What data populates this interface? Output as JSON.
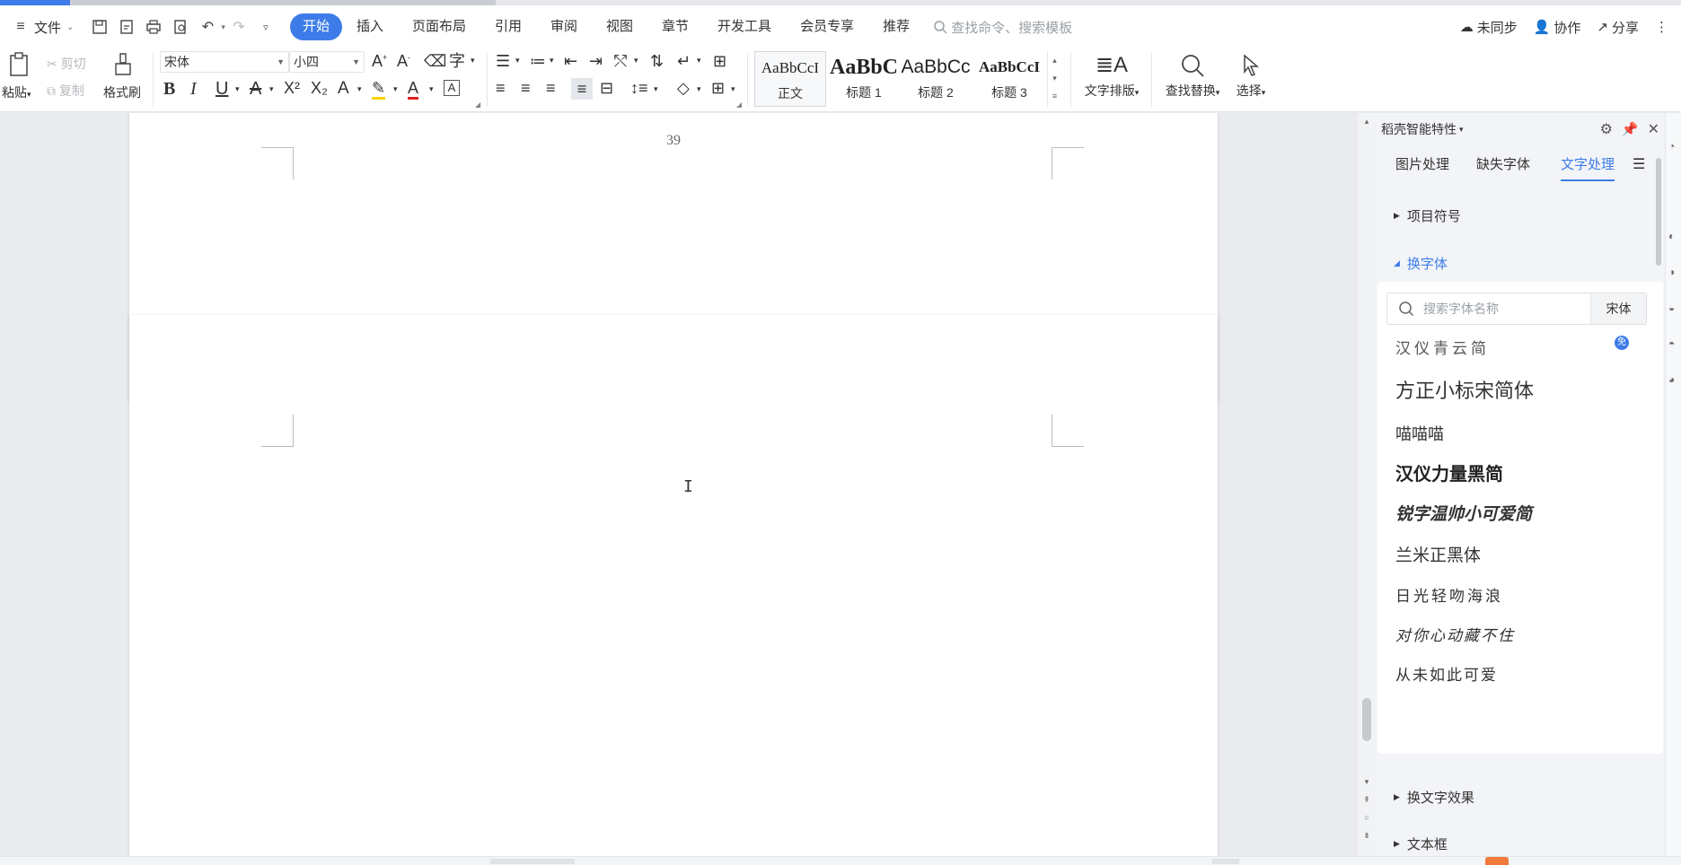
{
  "menubar": {
    "file_label": "文件",
    "tabs": [
      {
        "label": "开始",
        "active": true
      },
      {
        "label": "插入",
        "active": false
      },
      {
        "label": "页面布局",
        "active": false
      },
      {
        "label": "引用",
        "active": false
      },
      {
        "label": "审阅",
        "active": false
      },
      {
        "label": "视图",
        "active": false
      },
      {
        "label": "章节",
        "active": false
      },
      {
        "label": "开发工具",
        "active": false
      },
      {
        "label": "会员专享",
        "active": false
      },
      {
        "label": "推荐",
        "active": false
      }
    ],
    "search_placeholder": "查找命令、搜索模板",
    "sync_label": "未同步",
    "collab_label": "协作",
    "share_label": "分享"
  },
  "ribbon": {
    "paste_label": "粘贴",
    "cut_label": "剪切",
    "copy_label": "复制",
    "format_painter_label": "格式刷",
    "font_family_value": "宋体",
    "font_size_value": "小四",
    "styles": [
      {
        "sample": "AaBbCcI",
        "label": "正文",
        "selected": true
      },
      {
        "sample": "AaBbC",
        "label": "标题 1",
        "selected": false
      },
      {
        "sample": "AaBbCc",
        "label": "标题 2",
        "selected": false
      },
      {
        "sample": "AaBbCcI",
        "label": "标题 3",
        "selected": false
      }
    ],
    "text_layout_label": "文字排版",
    "find_replace_label": "查找替换",
    "select_label": "选择"
  },
  "document": {
    "page_number": "39"
  },
  "side_panel": {
    "title": "稻壳智能特性",
    "tabs": [
      {
        "label": "图片处理",
        "active": false
      },
      {
        "label": "缺失字体",
        "active": false
      },
      {
        "label": "文字处理",
        "active": true
      }
    ],
    "sections": {
      "bullets": "项目符号",
      "change_font": "换字体",
      "text_effects": "换文字效果",
      "text_box": "文本框"
    },
    "font_search_placeholder": "搜索字体名称",
    "current_font": "宋体",
    "fonts": [
      {
        "name": "汉仪青云简",
        "badge": "免"
      },
      {
        "name": "方正小标宋简体"
      },
      {
        "name": "喵喵喵"
      },
      {
        "name": "汉仪力量黑简"
      },
      {
        "name": "锐字温帅小可爱简"
      },
      {
        "name": "兰米正黑体"
      },
      {
        "name": "日光轻吻海浪"
      },
      {
        "name": "对你心动藏不住"
      },
      {
        "name": "从未如此可爱"
      }
    ]
  },
  "colors": {
    "accent": "#3d7ce8",
    "page_bg": "#e9ebee",
    "panel_bg": "#f2f4f7"
  }
}
